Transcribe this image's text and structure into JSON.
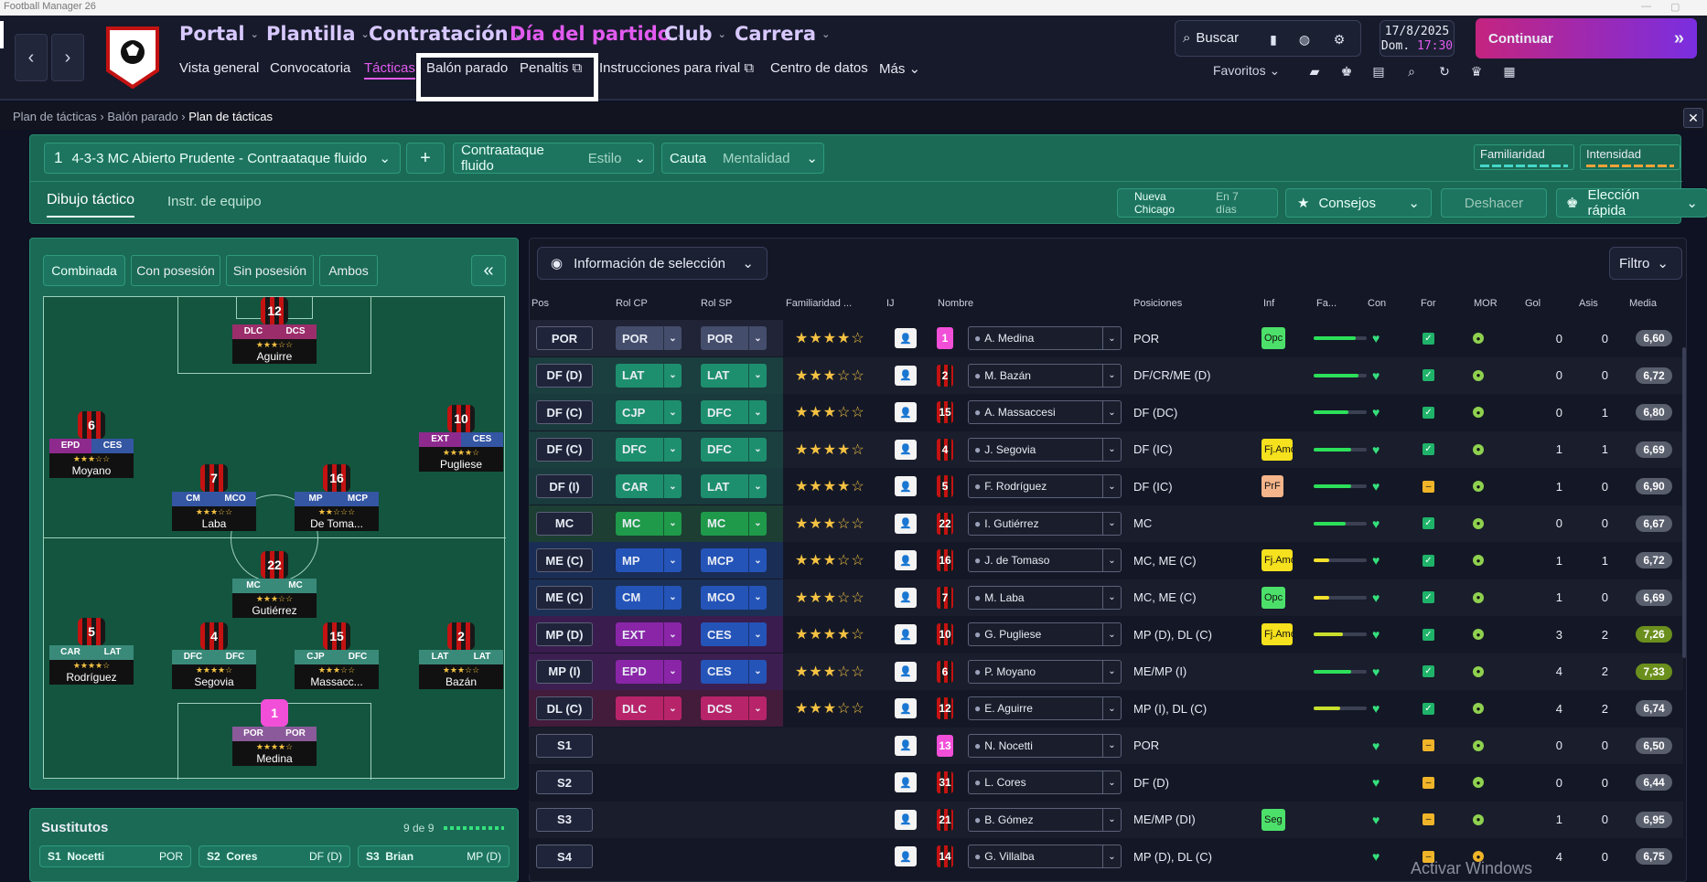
{
  "window": {
    "title": "Football Manager 26"
  },
  "nav": {
    "main": [
      "Portal",
      "Plantilla",
      "Contratación",
      "Día del partido",
      "Club",
      "Carrera"
    ],
    "sub": [
      "Vista general",
      "Convocatoria",
      "Tácticas",
      "Balón parado",
      "Penaltis",
      "Instrucciones para rival",
      "Centro de datos",
      "Más"
    ],
    "search_label": "Buscar",
    "date": "17/8/2025",
    "day_time": "Dom.",
    "time": "17:30",
    "continue_label": "Continuar",
    "favorites_label": "Favoritos"
  },
  "breadcrumb": [
    "Plan de tácticas",
    "Balón parado",
    "Plan de tácticas"
  ],
  "tactic": {
    "slot": "1",
    "name": "4-3-3 MC Abierto Prudente - Contraataque fluido",
    "add": "+",
    "style_value": "Contraataque fluido",
    "style_label": "Estilo",
    "mentality_value": "Cauta",
    "mentality_label": "Mentalidad",
    "familiarity_label": "Familiaridad",
    "intensity_label": "Intensidad",
    "tab_active": "Dibujo táctico",
    "tab_other": "Instr. de equipo",
    "next_match": "Nueva Chicago",
    "next_match_when": "En 7 días",
    "advice_label": "Consejos",
    "undo_label": "Deshacer",
    "quick_pick_label": "Elección rápida"
  },
  "pitch": {
    "filters": [
      "Combinada",
      "Con posesión",
      "Sin posesión",
      "Ambos"
    ],
    "collapse": "«",
    "players": [
      {
        "num": "12",
        "r1": "DLC",
        "r2": "DCS",
        "stars": "★★★☆☆",
        "name": "Aguirre",
        "gk": false
      },
      {
        "num": "6",
        "r1": "EPD",
        "r2": "CES",
        "stars": "★★★☆☆",
        "name": "Moyano",
        "gk": false
      },
      {
        "num": "10",
        "r1": "EXT",
        "r2": "CES",
        "stars": "★★★★☆",
        "name": "Pugliese",
        "gk": false
      },
      {
        "num": "7",
        "r1": "CM",
        "r2": "MCO",
        "stars": "★★★☆☆",
        "name": "Laba",
        "gk": false
      },
      {
        "num": "16",
        "r1": "MP",
        "r2": "MCP",
        "stars": "★★☆☆☆",
        "name": "De Toma...",
        "gk": false
      },
      {
        "num": "22",
        "r1": "MC",
        "r2": "MC",
        "stars": "★★★☆☆",
        "name": "Gutiérrez",
        "gk": false
      },
      {
        "num": "5",
        "r1": "CAR",
        "r2": "LAT",
        "stars": "★★★★☆",
        "name": "Rodríguez",
        "gk": false
      },
      {
        "num": "4",
        "r1": "DFC",
        "r2": "DFC",
        "stars": "★★★★☆",
        "name": "Segovia",
        "gk": false
      },
      {
        "num": "15",
        "r1": "CJP",
        "r2": "DFC",
        "stars": "★★★☆☆",
        "name": "Massacc...",
        "gk": false
      },
      {
        "num": "2",
        "r1": "LAT",
        "r2": "LAT",
        "stars": "★★★☆☆",
        "name": "Bazán",
        "gk": false
      },
      {
        "num": "1",
        "r1": "POR",
        "r2": "POR",
        "stars": "★★★★☆",
        "name": "Medina",
        "gk": true
      }
    ]
  },
  "subs": {
    "title": "Sustitutos",
    "count": "9 de 9",
    "items": [
      {
        "slot": "S1",
        "name": "Nocetti",
        "pos": "POR"
      },
      {
        "slot": "S2",
        "name": "Cores",
        "pos": "DF (D)"
      },
      {
        "slot": "S3",
        "name": "Brian",
        "pos": "MP (D)"
      }
    ]
  },
  "selection": {
    "info_label": "Información de selección",
    "filter_label": "Filtro",
    "headers": [
      "Pos",
      "Rol CP",
      "Rol SP",
      "Familiaridad ...",
      "IJ",
      "Nombre",
      "Posiciones",
      "Inf",
      "Fa...",
      "Con",
      "For",
      "MOR",
      "Gol",
      "Asis",
      "Media"
    ],
    "rows": [
      {
        "pos": "POR",
        "cp": "POR",
        "sp": "POR",
        "stars": "★★★★☆",
        "num": "1",
        "name": "A. Medina",
        "positions": "POR",
        "inf": "Opc",
        "fam": 0.8,
        "gol": "0",
        "asis": "0",
        "media": "6,60"
      },
      {
        "pos": "DF (D)",
        "cp": "LAT",
        "sp": "LAT",
        "stars": "★★★☆☆",
        "num": "2",
        "name": "M. Bazán",
        "positions": "DF/CR/ME (D)",
        "inf": "",
        "fam": 0.85,
        "gol": "0",
        "asis": "0",
        "media": "6,72"
      },
      {
        "pos": "DF (C)",
        "cp": "CJP",
        "sp": "DFC",
        "stars": "★★★☆☆",
        "num": "15",
        "name": "A. Massaccesi",
        "positions": "DF (DC)",
        "inf": "",
        "fam": 0.65,
        "gol": "0",
        "asis": "1",
        "media": "6,80"
      },
      {
        "pos": "DF (C)",
        "cp": "DFC",
        "sp": "DFC",
        "stars": "★★★★☆",
        "num": "4",
        "name": "J. Segovia",
        "positions": "DF (IC)",
        "inf": "Fj.Amo",
        "fam": 0.7,
        "gol": "1",
        "asis": "1",
        "media": "6,69"
      },
      {
        "pos": "DF (I)",
        "cp": "CAR",
        "sp": "LAT",
        "stars": "★★★★☆",
        "num": "5",
        "name": "F. Rodríguez",
        "positions": "DF (IC)",
        "inf": "PrF",
        "fam": 0.7,
        "gol": "1",
        "asis": "0",
        "media": "6,90"
      },
      {
        "pos": "MC",
        "cp": "MC",
        "sp": "MC",
        "stars": "★★★☆☆",
        "num": "22",
        "name": "I. Gutiérrez",
        "positions": "MC",
        "inf": "",
        "fam": 0.6,
        "gol": "0",
        "asis": "0",
        "media": "6,67"
      },
      {
        "pos": "ME (C)",
        "cp": "MP",
        "sp": "MCP",
        "stars": "★★★☆☆",
        "num": "16",
        "name": "J. de Tomaso",
        "positions": "MC, ME (C)",
        "inf": "Fj.Amo",
        "fam": 0.3,
        "gol": "1",
        "asis": "1",
        "media": "6,72"
      },
      {
        "pos": "ME (C)",
        "cp": "CM",
        "sp": "MCO",
        "stars": "★★★☆☆",
        "num": "7",
        "name": "M. Laba",
        "positions": "MC, ME (C)",
        "inf": "Opc",
        "fam": 0.3,
        "gol": "1",
        "asis": "0",
        "media": "6,69"
      },
      {
        "pos": "MP (D)",
        "cp": "EXT",
        "sp": "CES",
        "stars": "★★★★☆",
        "num": "10",
        "name": "G. Pugliese",
        "positions": "MP (D), DL (C)",
        "inf": "Fj.Amo",
        "fam": 0.55,
        "gol": "3",
        "asis": "2",
        "media": "7,26"
      },
      {
        "pos": "MP (I)",
        "cp": "EPD",
        "sp": "CES",
        "stars": "★★★☆☆",
        "num": "6",
        "name": "P. Moyano",
        "positions": "ME/MP (I)",
        "inf": "",
        "fam": 0.7,
        "gol": "4",
        "asis": "2",
        "media": "7,33"
      },
      {
        "pos": "DL (C)",
        "cp": "DLC",
        "sp": "DCS",
        "stars": "★★★☆☆",
        "num": "12",
        "name": "E. Aguirre",
        "positions": "MP (I), DL (C)",
        "inf": "",
        "fam": 0.5,
        "gol": "4",
        "asis": "2",
        "media": "6,74"
      },
      {
        "pos": "S1",
        "cp": "",
        "sp": "",
        "stars": "",
        "num": "13",
        "name": "N. Nocetti",
        "positions": "POR",
        "inf": "",
        "fam": 0,
        "gol": "0",
        "asis": "0",
        "media": "6,50"
      },
      {
        "pos": "S2",
        "cp": "",
        "sp": "",
        "stars": "",
        "num": "31",
        "name": "L. Cores",
        "positions": "DF (D)",
        "inf": "",
        "fam": 0,
        "gol": "0",
        "asis": "0",
        "media": "6,44"
      },
      {
        "pos": "S3",
        "cp": "",
        "sp": "",
        "stars": "",
        "num": "21",
        "name": "B. Gómez",
        "positions": "ME/MP (DI)",
        "inf": "Seg",
        "fam": 0,
        "gol": "1",
        "asis": "0",
        "media": "6,95"
      },
      {
        "pos": "S4",
        "cp": "",
        "sp": "",
        "stars": "",
        "num": "14",
        "name": "G. Villalba",
        "positions": "MP (D), DL (C)",
        "inf": "",
        "fam": 0,
        "gol": "4",
        "asis": "0",
        "media": "6,75"
      }
    ]
  },
  "watermark": "Activar Windows",
  "colors": {
    "accent": "#e25bf0",
    "continue_from": "#c4247f",
    "continue_to": "#7a2ee0",
    "pitch": "#13553f",
    "panel": "#1a6a55"
  }
}
